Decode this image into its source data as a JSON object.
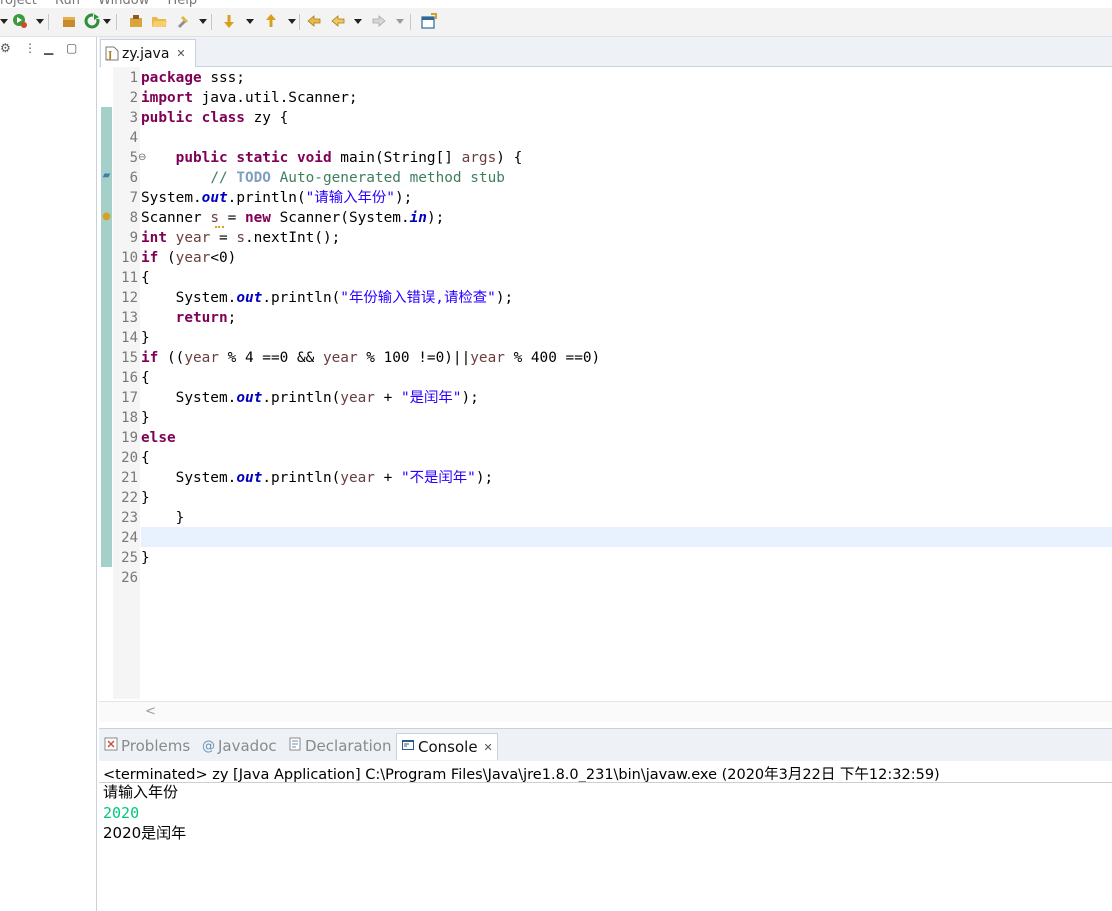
{
  "menubar": {
    "items": [
      "roject",
      "Run",
      "Window",
      "Help"
    ]
  },
  "toolbar": {
    "icons": [
      "run-icon",
      "debug-icon",
      "refresh-icon",
      "new-package-icon",
      "open-folder-icon",
      "pin-icon",
      "next-annotation-icon",
      "previous-annotation-icon",
      "last-edit-icon",
      "back-icon",
      "forward-icon",
      "open-perspective-icon"
    ]
  },
  "left_panel": {
    "controls": [
      "view-menu-icon",
      "minimize-icon",
      "maximize-icon"
    ]
  },
  "editor": {
    "tab": {
      "label": "zy.java",
      "close": "✕",
      "icon": "java-file-icon"
    },
    "line_numbers": [
      "1",
      "2",
      "3",
      "4",
      "5",
      "6",
      "7",
      "8",
      "9",
      "10",
      "11",
      "12",
      "13",
      "14",
      "15",
      "16",
      "17",
      "18",
      "19",
      "20",
      "21",
      "22",
      "23",
      "24",
      "25",
      "26"
    ],
    "fold_marker_line": "5",
    "current_line": "24",
    "lines": [
      "package sss;",
      "import java.util.Scanner;",
      "public class zy {",
      "",
      "    public static void main(String[] args) {",
      "        // TODO Auto-generated method stub",
      "System.out.println(\"请输入年份\");",
      "Scanner s = new Scanner(System.in);",
      "int year = s.nextInt();",
      "if (year<0)",
      "{",
      "    System.out.println(\"年份输入错误,请检查\");",
      "    return;",
      "}",
      "if ((year % 4 ==0 && year % 100 !=0)||year % 400 ==0)",
      "{",
      "    System.out.println(year + \"是闰年\");",
      "}",
      "else",
      "{",
      "    System.out.println(year + \"不是闰年\");",
      "}",
      "    }",
      "",
      "}",
      ""
    ]
  },
  "bottom_panel": {
    "tabs": [
      {
        "label": "Problems",
        "icon": "problems-icon",
        "active": false
      },
      {
        "label": "Javadoc",
        "icon": "javadoc-icon",
        "active": false
      },
      {
        "label": "Declaration",
        "icon": "declaration-icon",
        "active": false
      },
      {
        "label": "Console",
        "icon": "console-icon",
        "active": true,
        "close": "✕"
      }
    ],
    "console": {
      "status": "<terminated> zy [Java Application] C:\\Program Files\\Java\\jre1.8.0_231\\bin\\javaw.exe (2020年3月22日 下午12:32:59)",
      "output": [
        {
          "text": "请输入年份",
          "kind": "stdout"
        },
        {
          "text": "2020",
          "kind": "stdin"
        },
        {
          "text": "2020是闰年",
          "kind": "stdout"
        }
      ],
      "stdin_color": "#00c87d"
    }
  }
}
